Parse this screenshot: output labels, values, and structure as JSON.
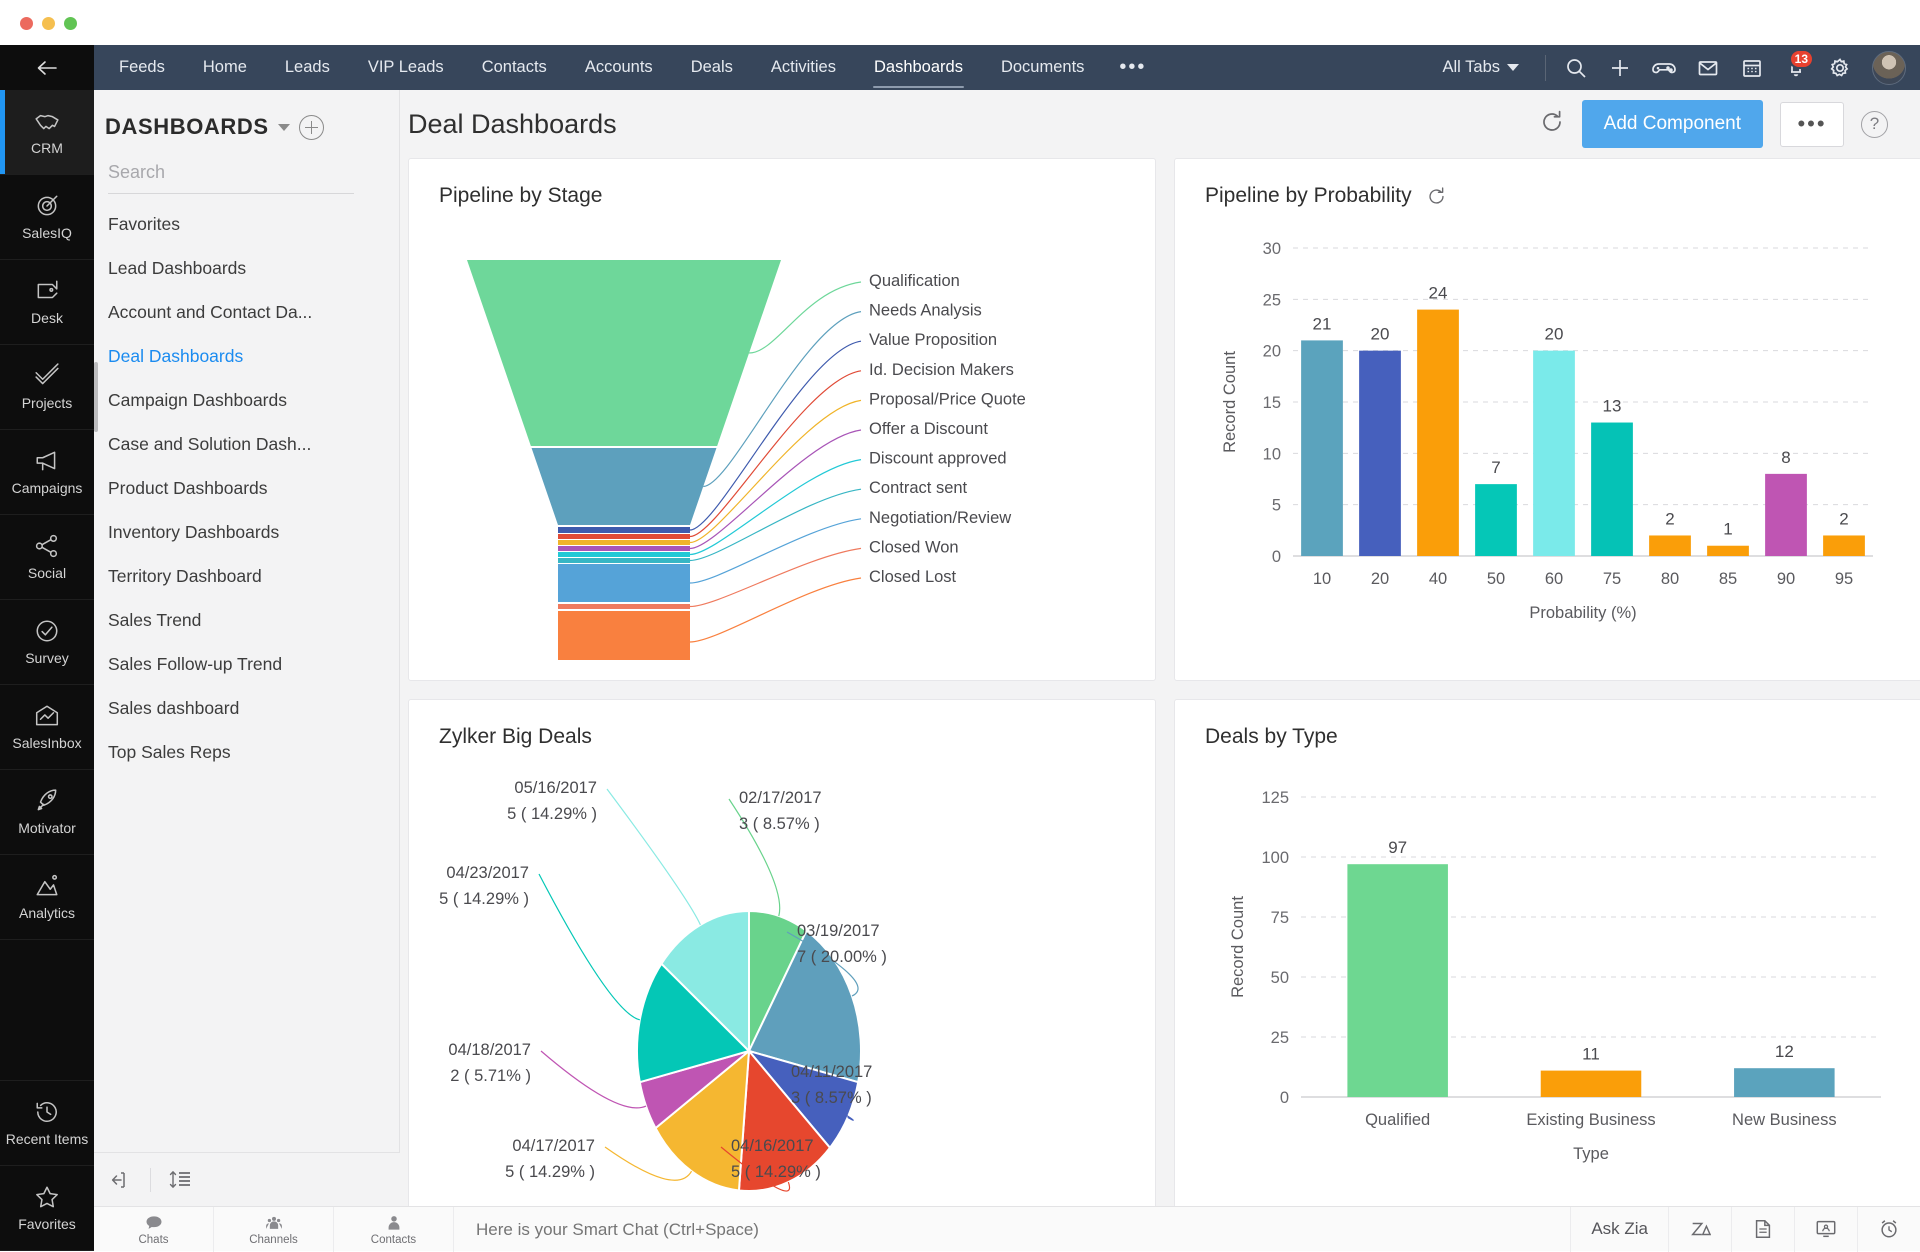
{
  "window": {
    "traffic_lights": [
      "close",
      "minimize",
      "zoom"
    ]
  },
  "topnav": {
    "back_icon": "back-arrow-icon",
    "tabs": [
      {
        "label": "Feeds",
        "active": false
      },
      {
        "label": "Home",
        "active": false
      },
      {
        "label": "Leads",
        "active": false
      },
      {
        "label": "VIP Leads",
        "active": false
      },
      {
        "label": "Contacts",
        "active": false
      },
      {
        "label": "Accounts",
        "active": false
      },
      {
        "label": "Deals",
        "active": false
      },
      {
        "label": "Activities",
        "active": false
      },
      {
        "label": "Dashboards",
        "active": true
      },
      {
        "label": "Documents",
        "active": false
      }
    ],
    "overflow_label": "•••",
    "all_tabs_label": "All Tabs",
    "icons": [
      "search-icon",
      "plus-icon",
      "gamepad-icon",
      "envelope-icon",
      "calendar-icon",
      "bell-icon",
      "gear-icon"
    ],
    "notification_count": "13",
    "avatar": "user-avatar"
  },
  "rail": {
    "items": [
      {
        "label": "CRM",
        "icon": "handshake-icon",
        "active": true
      },
      {
        "label": "SalesIQ",
        "icon": "target-icon",
        "active": false
      },
      {
        "label": "Desk",
        "icon": "headset-desk-icon",
        "active": false
      },
      {
        "label": "Projects",
        "icon": "double-check-icon",
        "active": false
      },
      {
        "label": "Campaigns",
        "icon": "megaphone-icon",
        "active": false
      },
      {
        "label": "Social",
        "icon": "share-nodes-icon",
        "active": false
      },
      {
        "label": "Survey",
        "icon": "check-circle-icon",
        "active": false
      },
      {
        "label": "SalesInbox",
        "icon": "inbox-icon",
        "active": false
      },
      {
        "label": "Motivator",
        "icon": "rocket-icon",
        "active": false
      },
      {
        "label": "Analytics",
        "icon": "chart-mountain-icon",
        "active": false
      }
    ],
    "bottom_items": [
      {
        "label": "Recent Items",
        "icon": "history-clock-icon"
      },
      {
        "label": "Favorites",
        "icon": "star-icon"
      }
    ]
  },
  "dashboards_panel": {
    "title": "DASHBOARDS",
    "dropdown_icon": "chevron-down-icon",
    "add_icon": "plus-circle-icon",
    "search_placeholder": "Search",
    "search_value": "",
    "items": [
      {
        "label": "Favorites",
        "selected": false
      },
      {
        "label": "Lead Dashboards",
        "selected": false
      },
      {
        "label": "Account and Contact Da...",
        "selected": false
      },
      {
        "label": "Deal Dashboards",
        "selected": true
      },
      {
        "label": "Campaign Dashboards",
        "selected": false
      },
      {
        "label": "Case and Solution Dash...",
        "selected": false
      },
      {
        "label": "Product Dashboards",
        "selected": false
      },
      {
        "label": "Inventory Dashboards",
        "selected": false
      },
      {
        "label": "Territory Dashboard",
        "selected": false
      },
      {
        "label": "Sales Trend",
        "selected": false
      },
      {
        "label": "Sales Follow-up Trend",
        "selected": false
      },
      {
        "label": "Sales dashboard",
        "selected": false
      },
      {
        "label": "Top Sales Reps",
        "selected": false
      }
    ],
    "footer_icons": [
      "collapse-panel-icon",
      "sort-list-icon"
    ]
  },
  "content_header": {
    "page_title": "Deal Dashboards",
    "refresh_icon": "refresh-icon",
    "add_component_label": "Add Component",
    "more_label": "•••",
    "help_label": "?"
  },
  "chart_data": [
    {
      "type": "funnel",
      "title": "Pipeline by Stage",
      "categories": [
        "Qualification",
        "Needs Analysis",
        "Value Proposition",
        "Id. Decision Makers",
        "Proposal/Price Quote",
        "Offer a Discount",
        "Discount approved",
        "Contract sent",
        "Negotiation/Review",
        "Closed Won",
        "Closed Lost"
      ],
      "values": [
        100,
        29,
        2,
        1,
        1,
        1,
        1,
        1,
        12,
        1,
        25
      ],
      "colors": [
        "#6ed79a",
        "#5da0bd",
        "#3e5aad",
        "#e04a36",
        "#f0b429",
        "#a855b7",
        "#22c9d6",
        "#37b6c4",
        "#55a3d8",
        "#ef7a5e",
        "#f9803f"
      ],
      "legend_position": "right"
    },
    {
      "type": "bar",
      "title": "Pipeline by Probability",
      "refresh_icon": "refresh-icon",
      "categories": [
        "10",
        "20",
        "40",
        "50",
        "60",
        "75",
        "80",
        "85",
        "90",
        "95"
      ],
      "values": [
        21,
        20,
        24,
        7,
        20,
        13,
        2,
        1,
        8,
        2
      ],
      "colors": [
        "#5ba3bd",
        "#4660bd",
        "#fa9e09",
        "#05c7b7",
        "#7aeaea",
        "#05c2b6",
        "#fa9e09",
        "#fa9e09",
        "#bf55b3",
        "#fa9e09"
      ],
      "xlabel": "Probability (%)",
      "ylabel": "Record Count",
      "yticks": [
        0,
        5,
        10,
        15,
        20,
        25,
        30
      ],
      "ylim": [
        0,
        30
      ],
      "grid": true
    },
    {
      "type": "pie",
      "title": "Zylker Big Deals",
      "labels": [
        "02/17/2017",
        "03/19/2017",
        "04/11/2017",
        "04/16/2017",
        "04/17/2017",
        "04/18/2017",
        "04/23/2017",
        "05/16/2017"
      ],
      "values": [
        3,
        7,
        3,
        5,
        5,
        2,
        5,
        5
      ],
      "percents": [
        "8.57%",
        "20.00%",
        "8.57%",
        "14.29%",
        "14.29%",
        "5.71%",
        "14.29%",
        "14.29%"
      ],
      "annotations": [
        "02/17/2017\n3 ( 8.57% )",
        "03/19/2017\n7 ( 20.00% )",
        "04/11/2017\n3 ( 8.57% )",
        "04/16/2017\n5 ( 14.29% )",
        "04/17/2017\n5 ( 14.29% )",
        "04/18/2017\n2 ( 5.71% )",
        "04/23/2017\n5 ( 14.29% )",
        "05/16/2017\n5 ( 14.29% )"
      ],
      "colors": [
        "#69d38c",
        "#5f9fbc",
        "#4660bd",
        "#e6472e",
        "#f5b731",
        "#bf55b3",
        "#04c7b6",
        "#8aeae3"
      ]
    },
    {
      "type": "bar",
      "title": "Deals by Type",
      "categories": [
        "Qualified",
        "Existing Business",
        "New Business"
      ],
      "values": [
        97,
        11,
        12
      ],
      "colors": [
        "#6ed791",
        "#fa9e09",
        "#5ba3bd"
      ],
      "xlabel": "Type",
      "ylabel": "Record Count",
      "yticks": [
        0,
        25,
        50,
        75,
        100,
        125
      ],
      "ylim": [
        0,
        125
      ],
      "grid": true
    }
  ],
  "bottombar": {
    "items": [
      {
        "label": "Chats",
        "icon": "chat-bubble-icon"
      },
      {
        "label": "Channels",
        "icon": "channels-group-icon"
      },
      {
        "label": "Contacts",
        "icon": "person-icon"
      }
    ],
    "smartchat_placeholder": "Here is your Smart Chat (Ctrl+Space)",
    "smartchat_value": "",
    "right_items": [
      {
        "label": "Ask Zia",
        "icon": ""
      },
      {
        "label": "",
        "icon": "zia-logo-icon"
      },
      {
        "label": "",
        "icon": "document-icon"
      },
      {
        "label": "",
        "icon": "presentation-icon"
      },
      {
        "label": "",
        "icon": "alarm-clock-icon"
      }
    ]
  }
}
